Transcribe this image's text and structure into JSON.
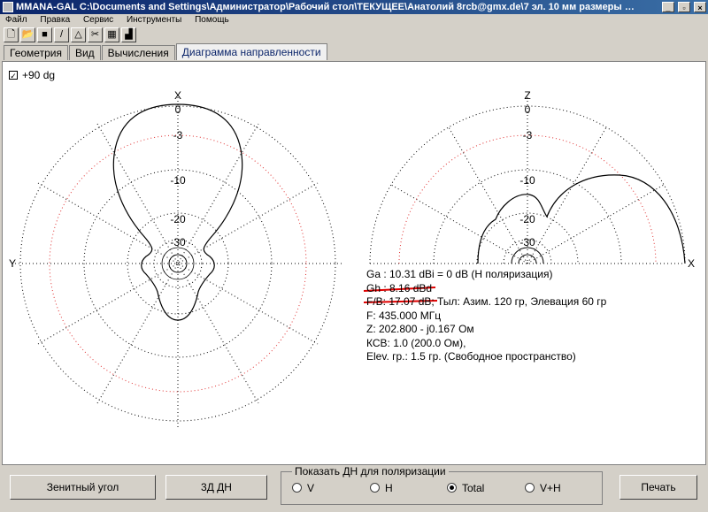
{
  "window": {
    "title": "MMANA-GAL C:\\Documents and Settings\\Администратор\\Рабочий стол\\ТЕКУЩЕЕ\\Анатолий 8rcb@gmx.de\\7 эл. 10 мм размеры родные KPOME длины W и р...",
    "minimize": "_",
    "maximize": "▫",
    "close": "×"
  },
  "menu": [
    "Файл",
    "Правка",
    "Сервис",
    "Инструменты",
    "Помощь"
  ],
  "toolbar": [
    "new-icon",
    "open-icon",
    "save-icon",
    "line-icon",
    "triangle-icon",
    "tools-icon",
    "calculator-icon",
    "chart-icon"
  ],
  "tabs": [
    {
      "label": "Геометрия",
      "active": false
    },
    {
      "label": "Вид",
      "active": false
    },
    {
      "label": "Вычисления",
      "active": false
    },
    {
      "label": "Диаграмма направленности",
      "active": true
    }
  ],
  "checkbox": {
    "label": "+90 dg",
    "checked": true
  },
  "plot_left": {
    "axis_top": "X",
    "axis_left": "Y",
    "rings": [
      "0",
      "-3",
      "-10",
      "-20",
      "-30"
    ]
  },
  "plot_right": {
    "axis_top": "Z",
    "axis_right": "X",
    "rings": [
      "0",
      "-3",
      "-10",
      "-20",
      "-30"
    ]
  },
  "info": {
    "ga": "Ga : 10.31 dBi = 0 dB  (H поляризация)",
    "gh": "Gh : 8.16 dBd",
    "fb": "F/B: 17.07 dB; Тыл: Азим. 120 гр, Элевация 60 гр",
    "freq": "F: 435.000 МГц",
    "z": "Z: 202.800 - j0.167 Ом",
    "swr": "КСВ: 1.0 (200.0 Ом),",
    "elev": "Elev. гр.: 1.5 гр. (Свободное пространство)"
  },
  "buttons": {
    "zenith": "Зенитный угол",
    "three_d": "3Д   ДН",
    "print": "Печать"
  },
  "polarization": {
    "legend": "Показать ДН для поляризации",
    "options": [
      {
        "label": "V",
        "selected": false
      },
      {
        "label": "H",
        "selected": false
      },
      {
        "label": "Total",
        "selected": true
      },
      {
        "label": "V+H",
        "selected": false
      }
    ]
  },
  "colors": {
    "highlight_line": "#e00000",
    "grid_dotted": "#000000",
    "grid_red": "#e03030"
  }
}
